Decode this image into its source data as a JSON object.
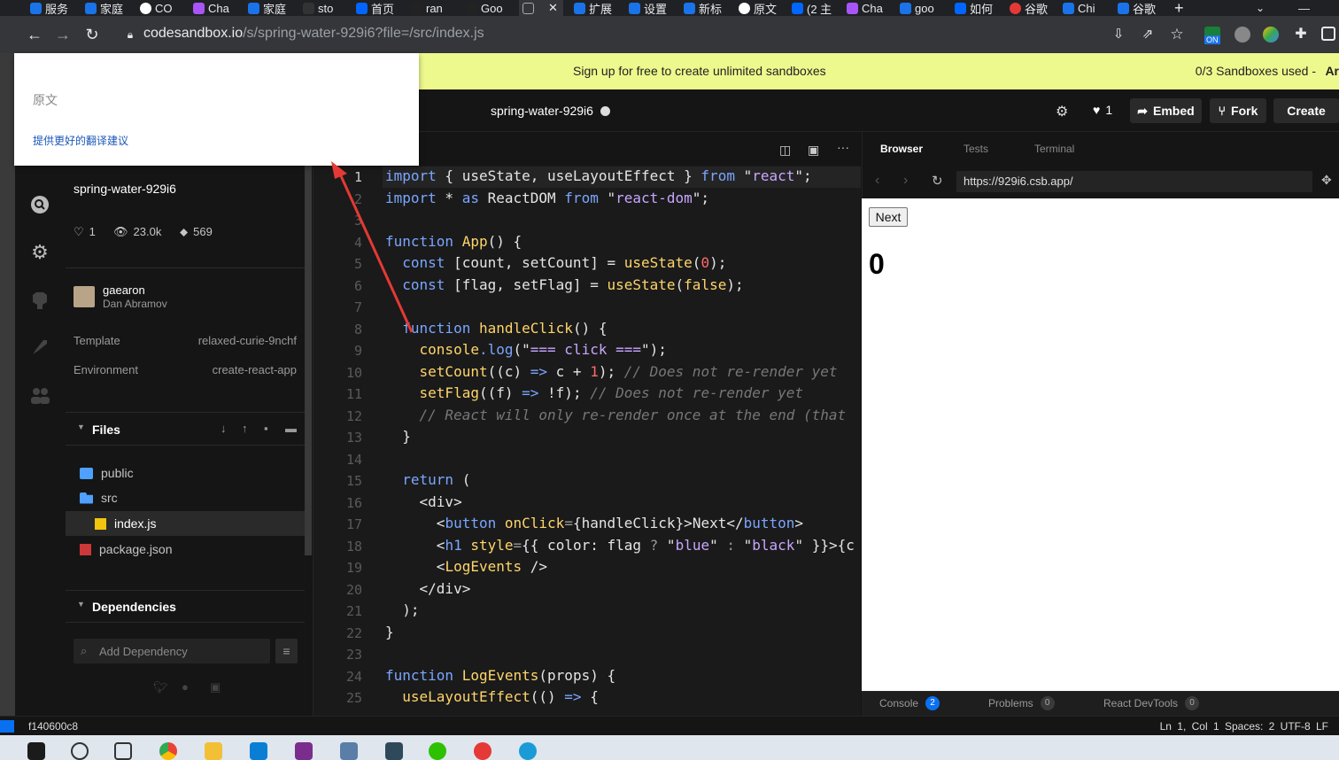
{
  "browser": {
    "tabs": [
      "服务",
      "家庭",
      "CO",
      "Cha",
      "家庭",
      "sto",
      "首页",
      "ran",
      "Goo",
      "",
      "扩展",
      "设置",
      "新标",
      "原文",
      "(2 主",
      "Cha",
      "goo",
      "如何",
      "谷歌",
      "Chi",
      "谷歌"
    ],
    "address_host": "codesandbox.io",
    "address_path": "/s/spring-water-929i6?file=/src/index.js",
    "ext_on_label": "ON"
  },
  "banner": {
    "text": "Sign up for free to create unlimited sandboxes",
    "count": "0/3 Sandboxes used -",
    "extra": "Ar"
  },
  "header": {
    "title": "spring-water-929i6",
    "likes": "1",
    "embed_label": "Embed",
    "fork_label": "Fork",
    "create_label": "Create"
  },
  "popup": {
    "original_label": "原文",
    "suggest_label": "提供更好的翻译建议"
  },
  "sidebar": {
    "sandbox_name": "spring-water-929i6",
    "stats": {
      "likes": "1",
      "views": "23.0k",
      "forks": "569"
    },
    "author": {
      "username": "gaearon",
      "name": "Dan Abramov"
    },
    "template_label": "Template",
    "template_value": "relaxed-curie-9nchf",
    "environment_label": "Environment",
    "environment_value": "create-react-app",
    "files_title": "Files",
    "files": [
      {
        "name": "public",
        "type": "folder"
      },
      {
        "name": "src",
        "type": "folder-open"
      },
      {
        "name": "index.js",
        "type": "js"
      },
      {
        "name": "package.json",
        "type": "npm"
      }
    ],
    "dependencies_title": "Dependencies",
    "add_dependency_placeholder": "Add Dependency"
  },
  "editor": {
    "line_numbers": [
      "1",
      "2",
      "3",
      "4",
      "5",
      "6",
      "7",
      "8",
      "9",
      "10",
      "11",
      "12",
      "13",
      "14",
      "15",
      "16",
      "17",
      "18",
      "19",
      "20",
      "21",
      "22",
      "23",
      "24",
      "25"
    ]
  },
  "preview": {
    "tabs": [
      "Browser",
      "Tests",
      "Terminal"
    ],
    "url": "https://929i6.csb.app/",
    "next_button": "Next",
    "count": "0",
    "devtools": [
      {
        "label": "Console",
        "count": "2"
      },
      {
        "label": "Problems",
        "count": "0"
      },
      {
        "label": "React DevTools",
        "count": "0"
      }
    ]
  },
  "statusbar": {
    "left": "f140600c8",
    "right": "Ln 1, Col 1   Spaces: 2   UTF-8   LF"
  },
  "colors": {
    "banner": "#eef98d",
    "accent_blue": "#0971f1",
    "annotation_red": "#e53935"
  }
}
